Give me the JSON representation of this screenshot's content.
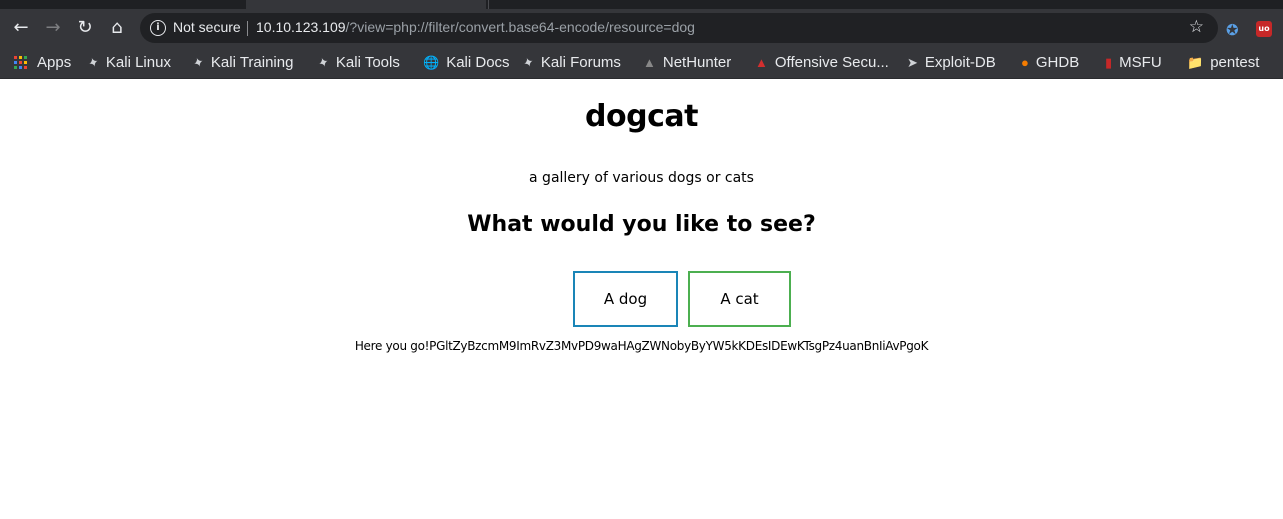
{
  "browser": {
    "back_icon": "arrow-left-icon",
    "forward_icon": "arrow-right-icon",
    "reload_icon": "reload-icon",
    "home_icon": "home-icon",
    "security_label": "Not secure",
    "url_host": "10.10.123.109",
    "url_path": "/?view=php://filter/convert.base64-encode/resource=dog",
    "bookmark_star_icon": "star-icon"
  },
  "bookmarks": {
    "items": [
      {
        "label": "Apps",
        "icon": "apps-grid-icon"
      },
      {
        "label": "Kali Linux",
        "icon": "kali-dragon-icon"
      },
      {
        "label": "Kali Training",
        "icon": "kali-dragon-icon"
      },
      {
        "label": "Kali Tools",
        "icon": "kali-dragon-icon"
      },
      {
        "label": "Kali Docs",
        "icon": "globe-icon"
      },
      {
        "label": "Kali Forums",
        "icon": "kali-dragon-icon"
      },
      {
        "label": "NetHunter",
        "icon": "nethunter-icon"
      },
      {
        "label": "Offensive Secu...",
        "icon": "offsec-icon"
      },
      {
        "label": "Exploit-DB",
        "icon": "exploitdb-icon"
      },
      {
        "label": "GHDB",
        "icon": "ghdb-icon"
      },
      {
        "label": "MSFU",
        "icon": "msfu-icon"
      },
      {
        "label": "pentest",
        "icon": "folder-icon"
      }
    ]
  },
  "page": {
    "title": "dogcat",
    "subtitle": "a gallery of various dogs or cats",
    "question": "What would you like to see?",
    "dog_button": "A dog",
    "cat_button": "A cat",
    "output": "Here you go!PGltZyBzcmM9ImRvZ3MvPD9waHAgZWNobyByYW5kKDEsIDEwKTsgPz4uanBnIiAvPgoK"
  },
  "colors": {
    "chrome_bg": "#35363a",
    "omnibox_bg": "#202124",
    "dog_button_border": "#1a85b7",
    "cat_button_border": "#4caf50"
  }
}
